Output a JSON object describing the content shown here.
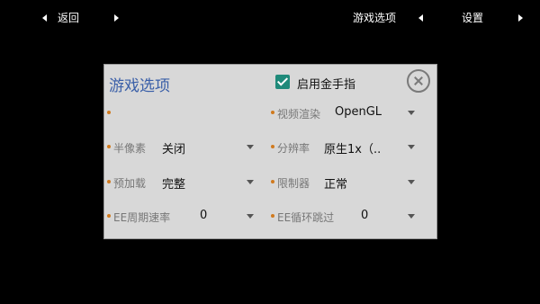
{
  "topbar": {
    "back_label": "返回",
    "game_options_label": "游戏选项",
    "settings_label": "设置"
  },
  "dialog": {
    "title": "游戏选项",
    "cheat_label": "启用金手指",
    "cheat_checked": true,
    "rows": [
      {
        "left": {
          "label": "",
          "value": ""
        },
        "right": {
          "label": "视频渲染",
          "value": "OpenGL"
        }
      },
      {
        "left": {
          "label": "半像素",
          "value": "关闭"
        },
        "right": {
          "label": "分辨率",
          "value": "原生1x（.."
        }
      },
      {
        "left": {
          "label": "预加载",
          "value": "完整"
        },
        "right": {
          "label": "限制器",
          "value": "正常"
        }
      },
      {
        "left": {
          "label": "EE周期速率",
          "value": "0"
        },
        "right": {
          "label": "EE循环跳过",
          "value": "0"
        }
      }
    ]
  },
  "colors": {
    "title": "#3a5fa8",
    "checkbox": "#1f8a7a",
    "bullet": "#d07a1e",
    "dialog_bg": "#d8d8d8"
  }
}
